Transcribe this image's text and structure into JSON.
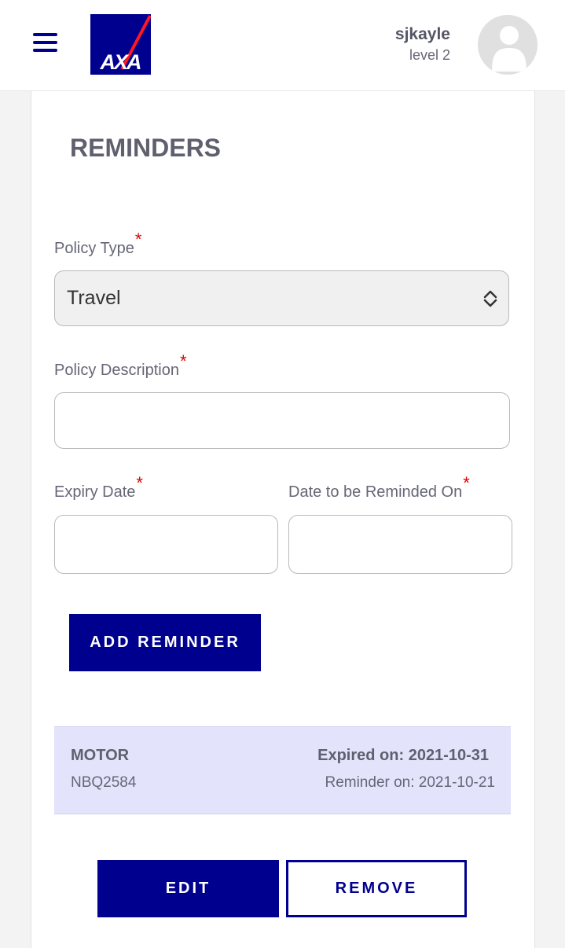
{
  "header": {
    "brand": "AXA",
    "user": {
      "name": "sjkayle",
      "level": "level 2"
    }
  },
  "colors": {
    "brand_blue": "#00008f",
    "brand_red": "#ff1721",
    "required_marker": "#e00000",
    "reminder_bg": "#e3e3fb"
  },
  "icons": {
    "menu": "hamburger-menu-icon",
    "avatar": "user-silhouette-icon",
    "select": "up-down-chevron-icon"
  },
  "page": {
    "title": "REMINDERS"
  },
  "form": {
    "policy_type": {
      "label": "Policy Type",
      "required_mark": "*",
      "value": "Travel"
    },
    "policy_description": {
      "label": "Policy Description",
      "required_mark": "*",
      "value": ""
    },
    "expiry_date": {
      "label": "Expiry Date",
      "required_mark": "*",
      "value": ""
    },
    "remind_date": {
      "label": "Date to be Reminded On",
      "required_mark": "*",
      "value": ""
    },
    "add_button": "ADD REMINDER"
  },
  "reminders": [
    {
      "type": "MOTOR",
      "description": "NBQ2584",
      "expired": "Expired on: 2021-10-31",
      "reminder": "Reminder on: 2021-10-21"
    }
  ],
  "actions": {
    "edit": "EDIT",
    "remove": "REMOVE"
  }
}
